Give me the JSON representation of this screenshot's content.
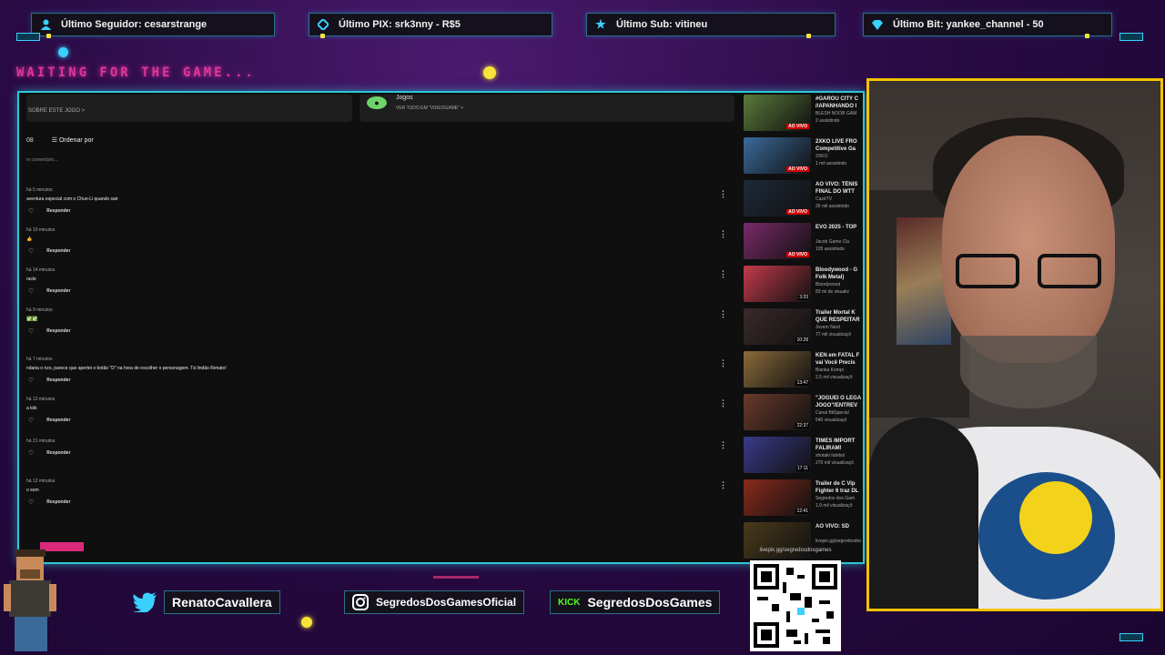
{
  "alerts": [
    {
      "label": "Último Seguidor: cesarstrange",
      "icon": "person-icon"
    },
    {
      "label": "Último PIX: srk3nny - R$5",
      "icon": "pix-icon"
    },
    {
      "label": "Último Sub: vitineu",
      "icon": "star-icon"
    },
    {
      "label": "Último Bit: yankee_channel - 50",
      "icon": "diamond-icon"
    }
  ],
  "waiting_text": "WAITING FOR THE GAME...",
  "youtube": {
    "about_label": "SOBRE ESTE JOGO  >",
    "game_name": "Jogos",
    "game_sub": "VER TUDO EM \"VIDEOGAME\"  >",
    "comments_count": "08",
    "sort_label": "Ordenar por",
    "add_comment": "m comentário...",
    "reply_label": "Responder",
    "comments": [
      {
        "meta": "há 5 minutos",
        "text": "aventura especial com o Chun-Li quando sair"
      },
      {
        "meta": "há 10 minutos",
        "text": "👍"
      },
      {
        "meta": "há 14 minutos",
        "text": "racle"
      },
      {
        "meta": "há 9 minutos",
        "text": "✅✅"
      },
      {
        "meta": "há 7 minutos",
        "text": "ndaria o nzo, parece que apertei o botão \"D\" na hora de escolher o personagem. Tá lindão Renato!"
      },
      {
        "meta": "há 12 minutos",
        "text": "a kkk"
      },
      {
        "meta": "há 21 minutos",
        "text": ""
      },
      {
        "meta": "há 12 minutos",
        "text": "o som"
      }
    ]
  },
  "sidebar_videos": [
    {
      "title": "#GAROU CITY C",
      "title2": "//APANHANDO I",
      "channel": "BLESH NOOB GAM",
      "views": "2 assistindo",
      "badge": "AO VIVO",
      "color": "#5a7a3a"
    },
    {
      "title": "2XKO LIVE FRO",
      "title2": "Competitive Ga",
      "channel": "2XKO",
      "views": "1 mil assistindo",
      "badge": "AO VIVO",
      "color": "#3a6a9a"
    },
    {
      "title": "AO VIVO: TÊNIS",
      "title2": "FINAL DO WTT",
      "channel": "CazéTV",
      "views": "26 mil assistindo",
      "badge": "AO VIVO",
      "color": "#1e2a3a"
    },
    {
      "title": "EVO 2025 - TOP",
      "title2": "",
      "channel": "Jacob Game Clu",
      "views": "105 assistindo",
      "badge": "AO VIVO",
      "color": "#7a2a6a"
    },
    {
      "title": "Bloodywood - G",
      "title2": "Folk Metal)",
      "channel": "Bloodywood",
      "views": "83 mi de visualiz",
      "badge": "3:33",
      "color": "#c43a4a"
    },
    {
      "title": "Trailer Mortal K",
      "title2": "QUE RESPEITAR",
      "channel": "Jovem Nerd",
      "views": "77 mil visualizaçõ",
      "badge": "10:28",
      "color": "#3a2a2a"
    },
    {
      "title": "KEN em FATAL F",
      "title2": "vai Você Precis",
      "channel": "Blanka Kompi",
      "views": "2,5 mil visualizaçõ",
      "badge": "13:47",
      "color": "#8a6a3a"
    },
    {
      "title": "\"JOGUEI O LEGA",
      "title2": "JOGO\"/ENTREV",
      "channel": "Canal BitSpecial",
      "views": "540 visualizaçõ",
      "badge": "22:37",
      "color": "#6a3a2a"
    },
    {
      "title": "TIMES IMPORT",
      "title2": "FALIRAM!",
      "channel": "shotaki futebol",
      "views": "270 mil visualizaçõ",
      "badge": "17:11",
      "color": "#3a3a8a"
    },
    {
      "title": "Trailer de C Vip",
      "title2": "Fighter 6 traz DL",
      "channel": "Segredos dos Gam",
      "views": "1,9 mil visualizaçõ",
      "badge": "12:41",
      "color": "#8a2a1a"
    },
    {
      "title": "AO VIVO: SD",
      "title2": "",
      "channel": "livepix.gg/segredosdosgames",
      "views": "",
      "badge": "",
      "color": "#4a3a1a"
    }
  ],
  "socials": [
    {
      "label": "RenatoCavallera",
      "icon": "twitter-icon"
    },
    {
      "label": "SegredosDosGamesOficial",
      "icon": "instagram-icon"
    },
    {
      "label": "SegredosDosGames",
      "icon": "kick-icon",
      "prefix": "KICK"
    }
  ],
  "qr_url": "livepix.gg/segredosdosgames",
  "colors": {
    "frame": "#2cc6d6",
    "cam_border": "#f3c300",
    "pink": "#ff3ca8",
    "bg": "#2a0a44"
  }
}
